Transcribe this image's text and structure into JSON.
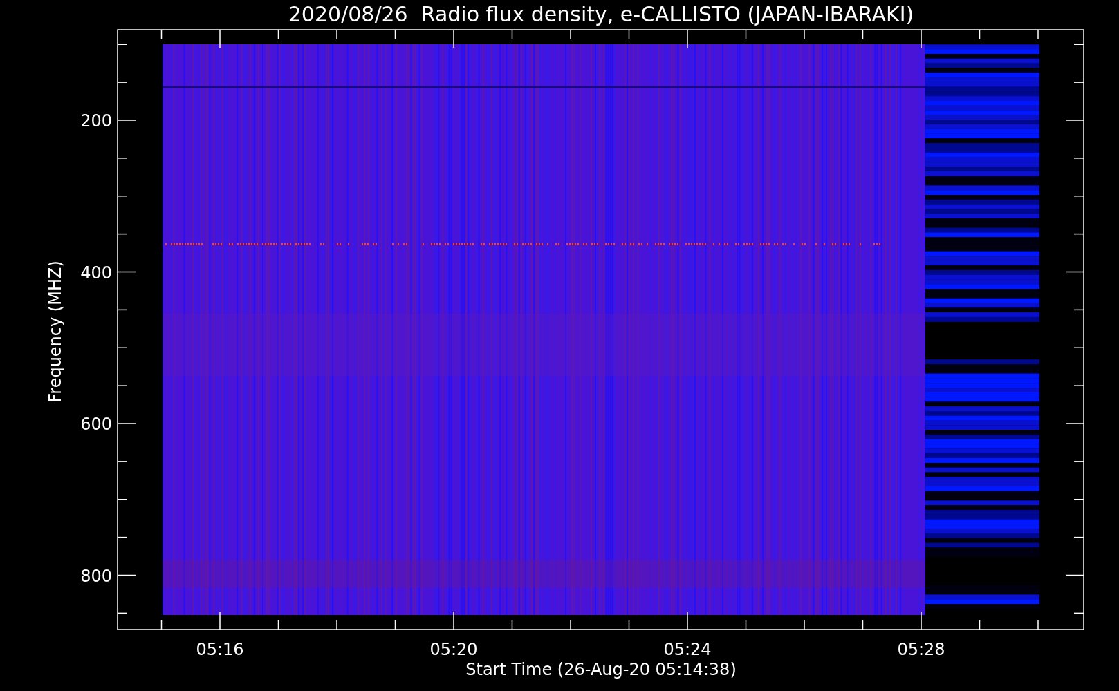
{
  "title": "2020/08/26  Radio flux density, e-CALLISTO (JAPAN-IBARAKI)",
  "y_axis": {
    "label": "Frequency (MHZ)",
    "ticks": [
      "200",
      "400",
      "600",
      "800"
    ]
  },
  "x_axis": {
    "label": "Start Time (26-Aug-20 05:14:38)",
    "ticks": [
      "05:16",
      "05:20",
      "05:24",
      "05:28"
    ]
  }
}
